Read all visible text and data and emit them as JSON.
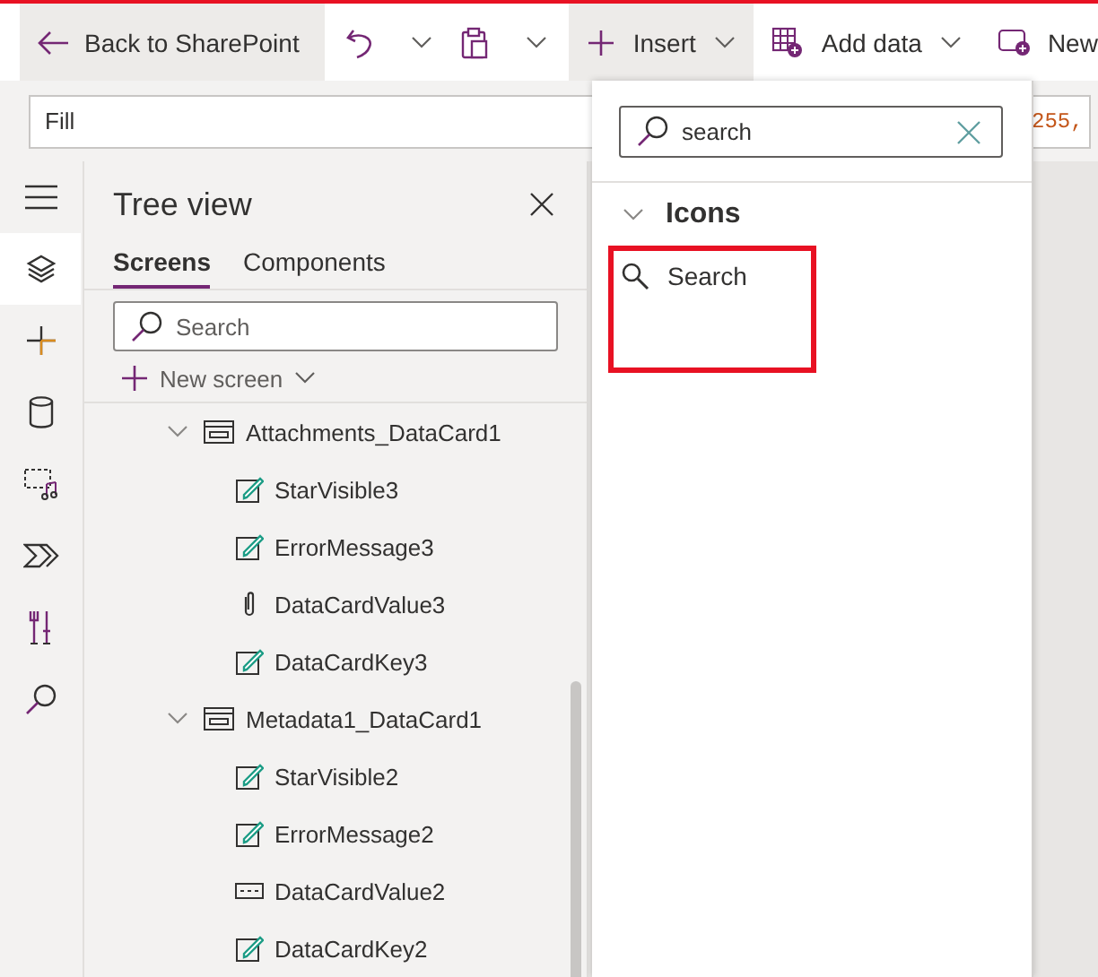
{
  "toolbar": {
    "back": "Back to SharePoint",
    "buttons": [
      {
        "kind": "insert",
        "label": "Insert",
        "selected": true
      },
      {
        "kind": "data",
        "label": "Add data",
        "selected": false
      },
      {
        "kind": "new",
        "label": "New",
        "selected": false
      }
    ]
  },
  "formula_bar": {
    "property": "Fill",
    "value": "255,"
  },
  "rail": [
    {
      "kind": "menu",
      "selected": false
    },
    {
      "kind": "layers",
      "selected": true
    },
    {
      "kind": "plus",
      "selected": false
    },
    {
      "kind": "database",
      "selected": false
    },
    {
      "kind": "media",
      "selected": false
    },
    {
      "kind": "flow",
      "selected": false
    },
    {
      "kind": "tools",
      "selected": false
    },
    {
      "kind": "search",
      "selected": false
    }
  ],
  "tree_view": {
    "title": "Tree view",
    "tabs": [
      {
        "label": "Screens",
        "selected": true
      },
      {
        "label": "Components",
        "selected": false
      }
    ],
    "search": {
      "placeholder": "Search"
    },
    "new_screen": "New screen",
    "items": [
      {
        "label": "Attachments_DataCard1",
        "kind": "card",
        "expanded": true,
        "children": [
          {
            "label": "StarVisible3",
            "kind": "label"
          },
          {
            "label": "ErrorMessage3",
            "kind": "label"
          },
          {
            "label": "DataCardValue3",
            "kind": "attachment"
          },
          {
            "label": "DataCardKey3",
            "kind": "label"
          }
        ]
      },
      {
        "label": "Metadata1_DataCard1",
        "kind": "card",
        "expanded": true,
        "children": [
          {
            "label": "StarVisible2",
            "kind": "label"
          },
          {
            "label": "ErrorMessage2",
            "kind": "label"
          },
          {
            "label": "DataCardValue2",
            "kind": "textinput"
          },
          {
            "label": "DataCardKey2",
            "kind": "label"
          }
        ]
      }
    ]
  },
  "insert_panel": {
    "search": {
      "value": "search"
    },
    "groups": [
      {
        "label": "Icons",
        "expanded": true,
        "items": [
          {
            "label": "Search",
            "highlighted": true
          }
        ]
      }
    ]
  }
}
